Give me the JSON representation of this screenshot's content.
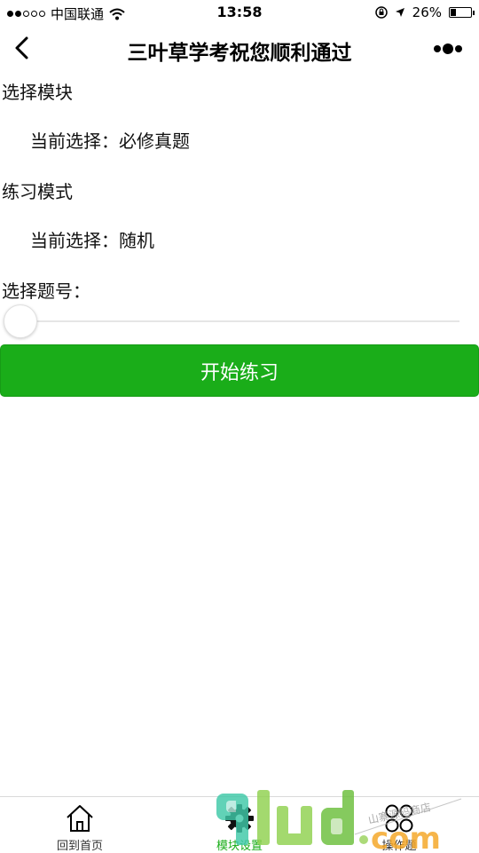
{
  "status_bar": {
    "carrier": "中国联通",
    "time": "13:58",
    "battery_text": "26%",
    "battery_level": 0.26,
    "signal_bars_filled": 2,
    "signal_bars_total": 5
  },
  "nav": {
    "title": "三叶草学考祝您顺利通过",
    "back_icon": "chevron-left-icon",
    "more_icon": "more-dots-icon"
  },
  "module": {
    "label": "选择模块",
    "current": "当前选择：必修真题"
  },
  "mode": {
    "label": "练习模式",
    "current": "当前选择：随机"
  },
  "question": {
    "label": "选择题号：",
    "slider_value": 0
  },
  "start_button": {
    "label": "开始练习"
  },
  "tabs": [
    {
      "label": "回到首页",
      "icon": "home-icon"
    },
    {
      "label": "模块设置",
      "icon": "gear-icon"
    },
    {
      "label": "操作题",
      "icon": "grid-circles-icon"
    }
  ],
  "watermark": {
    "logo_text": "9lud.com",
    "tagline": "山寨源码商店"
  },
  "colors": {
    "primary_green": "#1aad19",
    "background": "#ffffff"
  }
}
